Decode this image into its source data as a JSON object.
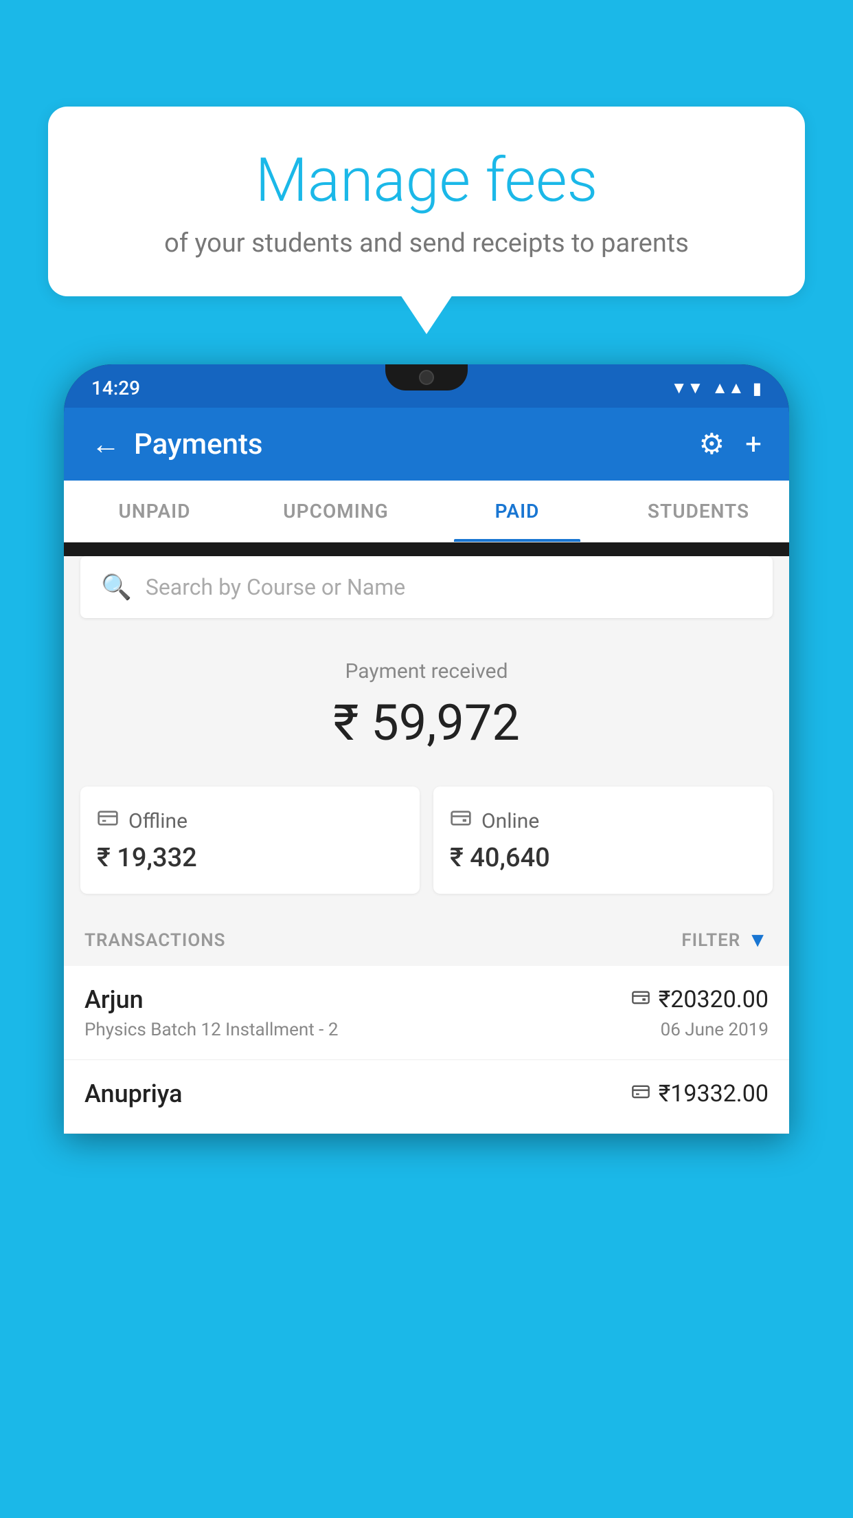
{
  "background_color": "#1BB8E8",
  "bubble": {
    "title": "Manage fees",
    "subtitle": "of your students and send receipts to parents"
  },
  "phone": {
    "status_bar": {
      "time": "14:29",
      "wifi_icon": "▼",
      "signal_icon": "▲",
      "battery_icon": "▮"
    },
    "header": {
      "back_label": "←",
      "title": "Payments",
      "settings_icon": "⚙",
      "add_icon": "+"
    },
    "tabs": [
      {
        "id": "unpaid",
        "label": "UNPAID",
        "active": false
      },
      {
        "id": "upcoming",
        "label": "UPCOMING",
        "active": false
      },
      {
        "id": "paid",
        "label": "PAID",
        "active": true
      },
      {
        "id": "students",
        "label": "STUDENTS",
        "active": false
      }
    ],
    "search": {
      "placeholder": "Search by Course or Name"
    },
    "payment_received": {
      "label": "Payment received",
      "amount": "₹ 59,972"
    },
    "offline_payment": {
      "icon": "💳",
      "label": "Offline",
      "amount": "₹ 19,332"
    },
    "online_payment": {
      "icon": "💳",
      "label": "Online",
      "amount": "₹ 40,640"
    },
    "transactions_section": {
      "label": "TRANSACTIONS",
      "filter_label": "FILTER"
    },
    "transactions": [
      {
        "name": "Arjun",
        "detail": "Physics Batch 12 Installment - 2",
        "amount": "₹20320.00",
        "date": "06 June 2019",
        "type": "online"
      },
      {
        "name": "Anupriya",
        "detail": "",
        "amount": "₹19332.00",
        "date": "",
        "type": "offline"
      }
    ]
  }
}
